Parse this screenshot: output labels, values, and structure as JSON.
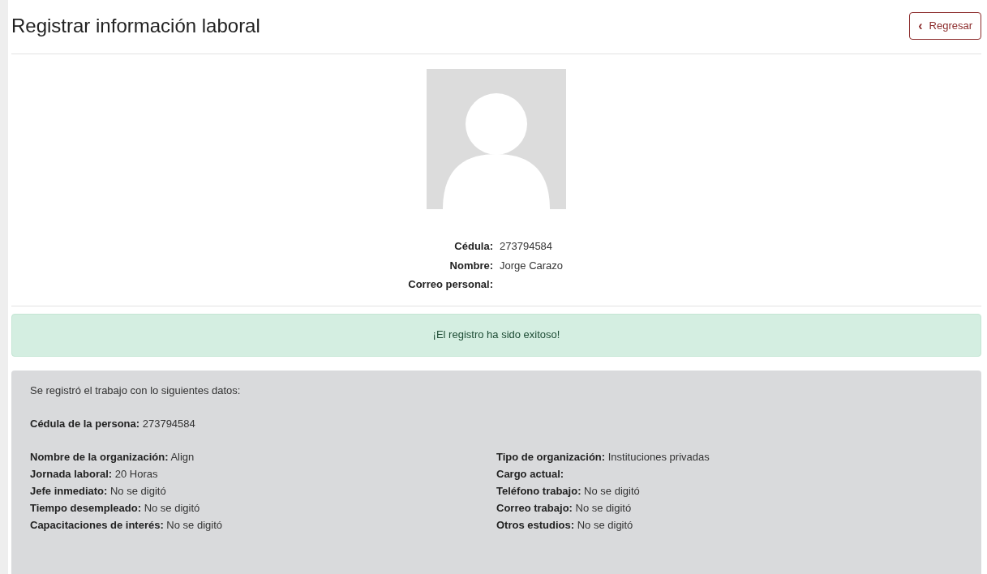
{
  "page": {
    "title": "Registrar información laboral",
    "back_button": {
      "icon": "‹",
      "label": "Regresar"
    }
  },
  "profile": {
    "avatar": {
      "kind": "placeholder"
    },
    "fields": [
      {
        "label": "Cédula:",
        "value": "273794584"
      },
      {
        "label": "Nombre:",
        "value": "Jorge Carazo"
      },
      {
        "label": "Correo personal:"
      }
    ]
  },
  "alert": {
    "kind": "success",
    "message": "¡El registro ha sido exitoso!"
  },
  "summary": {
    "intro": "Se registró el trabajo con lo siguientes datos:",
    "person": {
      "label": "Cédula de la persona:",
      "value": "273794584"
    },
    "left": [
      {
        "label": "Nombre de la organización:",
        "value": "Align"
      },
      {
        "label": "Jornada laboral:",
        "value": "20 Horas"
      },
      {
        "label": "Jefe inmediato:",
        "value": "No se digitó"
      },
      {
        "label": "Tiempo desempleado:",
        "value": "No se digitó"
      },
      {
        "label": "Capacitaciones de interés:",
        "value": "No se digitó"
      }
    ],
    "right": [
      {
        "label": "Tipo de organización:",
        "value": "Instituciones privadas"
      },
      {
        "label": "Cargo actual:"
      },
      {
        "label": "Teléfono trabajo:",
        "value": "No se digitó"
      },
      {
        "label": "Correo trabajo:",
        "value": "No se digitó"
      },
      {
        "label": "Otros estudios:",
        "value": "No se digitó"
      }
    ]
  }
}
